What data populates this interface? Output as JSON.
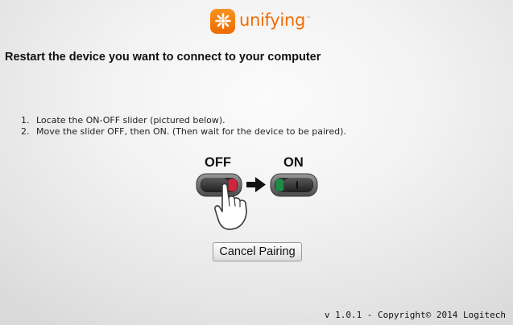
{
  "app": {
    "logo_text": "unifying",
    "logo_tm": "™",
    "brand_color": "#f26b00"
  },
  "heading": "Restart the device you want to connect to your computer",
  "steps": [
    {
      "num": "1.",
      "text": "Locate the ON-OFF slider (pictured below)."
    },
    {
      "num": "2.",
      "text": "Move the slider OFF, then ON. (Then wait for the device to be paired)."
    }
  ],
  "illustration": {
    "off_label": "OFF",
    "on_label": "ON",
    "off_color": "#d2233c",
    "on_color": "#1e8a44",
    "icons": [
      "slider-off-icon",
      "arrow-right-icon",
      "slider-on-icon",
      "hand-pointer-icon"
    ]
  },
  "buttons": {
    "cancel_label": "Cancel Pairing"
  },
  "footer": {
    "version": "v 1.0.1 - Copyright© 2014 Logitech"
  }
}
